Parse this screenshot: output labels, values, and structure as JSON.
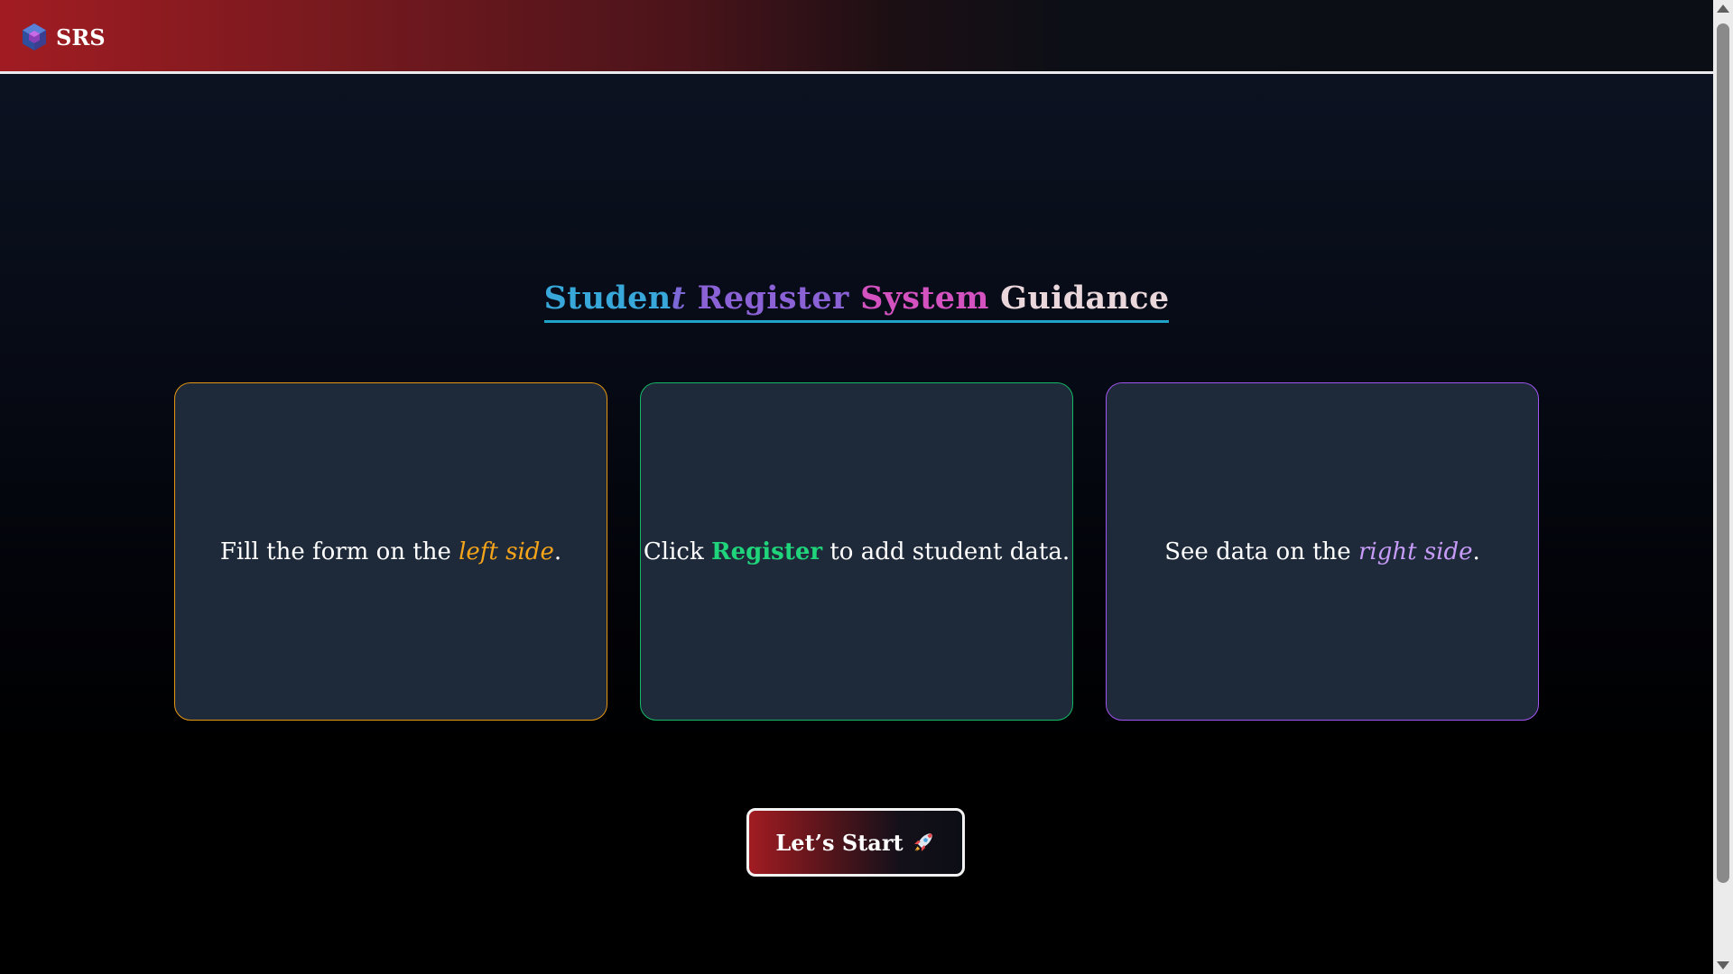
{
  "header": {
    "brand_name": "SRS",
    "logo_icon": "cube-logo-icon"
  },
  "title": {
    "part1": "Studen",
    "part1_italic": "t",
    "part2": "Register",
    "part3": "System",
    "part4": "Guidance"
  },
  "cards": [
    {
      "prefix": "Fill the form on the ",
      "highlight": "left side",
      "suffix": ".",
      "accent": "#e59612"
    },
    {
      "prefix": "Click ",
      "highlight": "Register",
      "suffix": " to add student data.",
      "accent": "#14b867"
    },
    {
      "prefix": "See data on the ",
      "highlight": "right side",
      "suffix": ".",
      "accent": "#a155f2"
    }
  ],
  "start_button": {
    "label": "Let’s Start",
    "icon": "rocket-icon"
  },
  "colors": {
    "header_red": "#a11c22",
    "title_underline": "#1fa3c9",
    "card_bg": "#1e2939"
  }
}
